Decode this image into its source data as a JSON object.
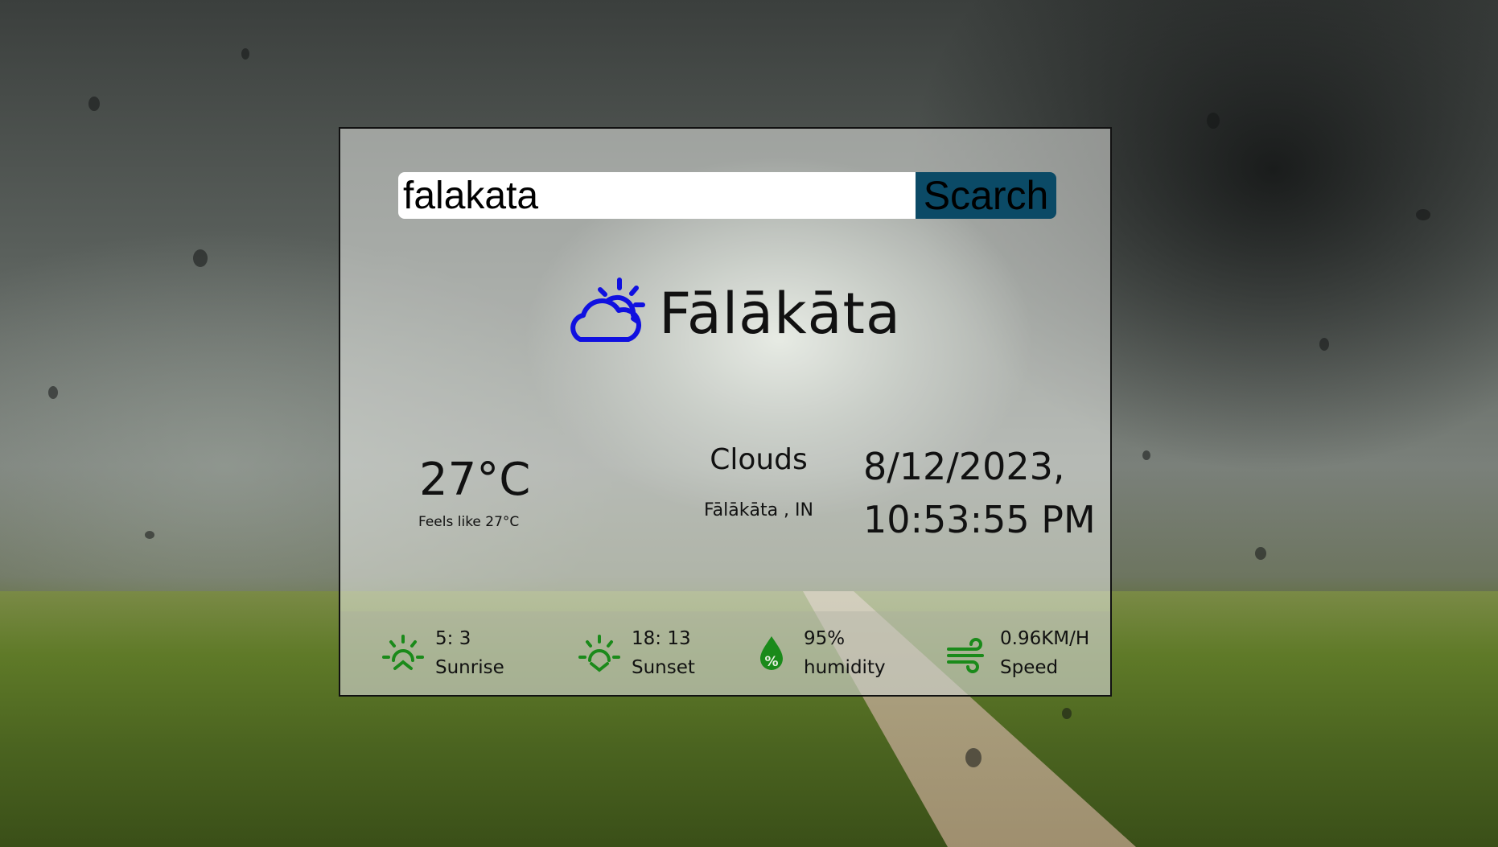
{
  "search": {
    "value": "falakata",
    "button_label": "Scarch"
  },
  "weather": {
    "icon": "cloud-sun-icon",
    "city": "Fālākāta",
    "temperature": "27°C",
    "feels_like": "Feels like 27°C",
    "condition": "Clouds",
    "location": "Fālākāta , IN",
    "date": "8/12/2023,",
    "time": "10:53:55 PM"
  },
  "stats": [
    {
      "icon": "sunrise-icon",
      "value": "5: 3",
      "label": "Sunrise"
    },
    {
      "icon": "sunset-icon",
      "value": "18: 13",
      "label": "Sunset"
    },
    {
      "icon": "humidity-drop-icon",
      "value": "95%",
      "label": "humidity"
    },
    {
      "icon": "wind-icon",
      "value": "0.96KM/H",
      "label": "Speed"
    }
  ],
  "colors": {
    "icon_blue": "#1010e0",
    "stat_icon_green": "#1a8a1a",
    "button_bg": "#0b4a66"
  }
}
